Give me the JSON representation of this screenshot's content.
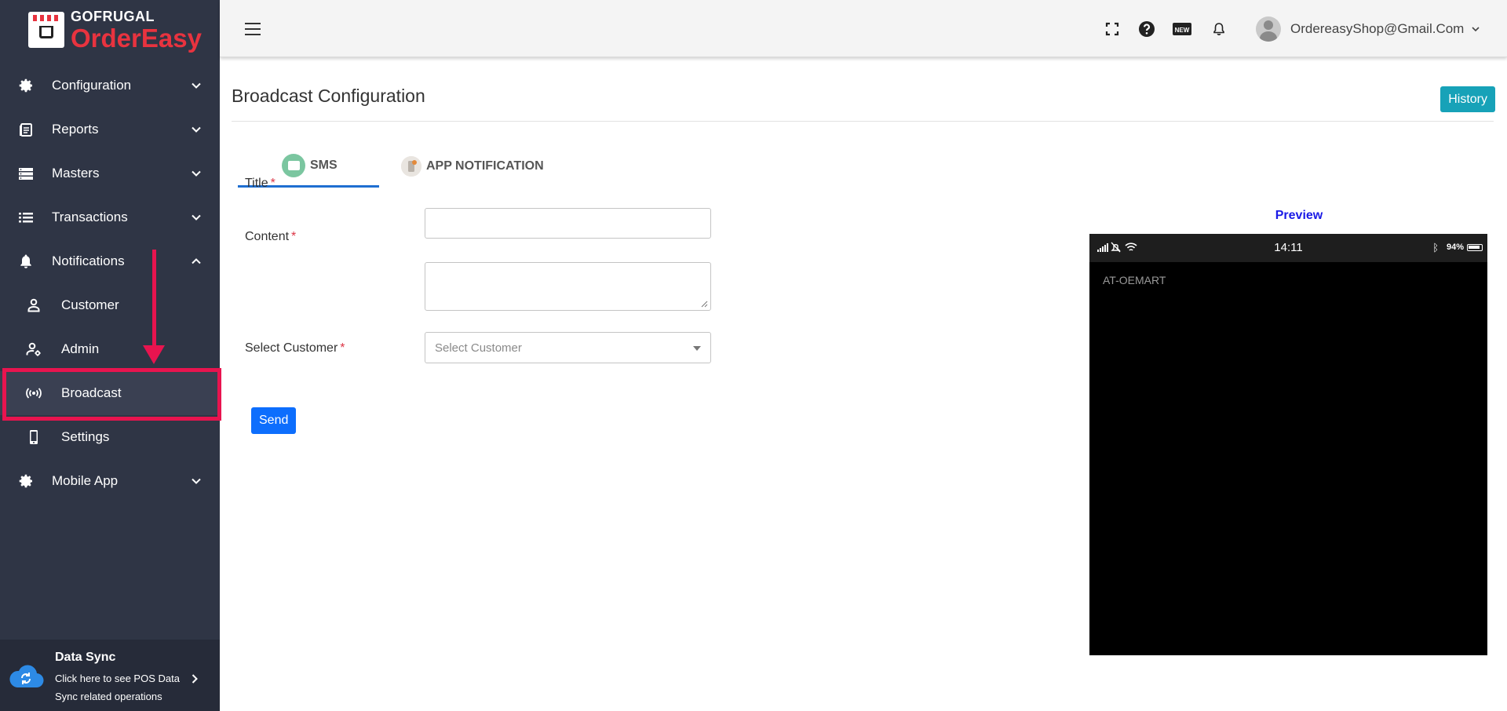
{
  "app": {
    "brand_top": "GOFRUGAL",
    "brand_bottom": "OrderEasy"
  },
  "sidebar": {
    "items": [
      {
        "label": "Configuration",
        "icon": "gear-icon"
      },
      {
        "label": "Reports",
        "icon": "reports-icon"
      },
      {
        "label": "Masters",
        "icon": "masters-icon"
      },
      {
        "label": "Transactions",
        "icon": "list-icon"
      },
      {
        "label": "Notifications",
        "icon": "bell-icon",
        "expanded": true
      },
      {
        "label": "Mobile App",
        "icon": "gear-icon"
      }
    ],
    "notifications_sub": [
      {
        "label": "Customer",
        "icon": "user-icon"
      },
      {
        "label": "Admin",
        "icon": "user-gear-icon"
      },
      {
        "label": "Broadcast",
        "icon": "broadcast-icon",
        "active": true
      },
      {
        "label": "Settings",
        "icon": "phone-icon"
      }
    ],
    "datasync": {
      "title": "Data Sync",
      "description": "Click here to see POS Data Sync related operations"
    }
  },
  "topbar": {
    "icons": [
      "fullscreen-icon",
      "help-icon",
      "new-icon",
      "bell-icon"
    ],
    "user_email": "OrdereasyShop@Gmail.Com"
  },
  "page": {
    "title": "Broadcast Configuration",
    "history_label": "History",
    "tabs": [
      {
        "label": "SMS",
        "active": true
      },
      {
        "label": "APP NOTIFICATION",
        "active": false
      }
    ],
    "form": {
      "title_label": "Title",
      "content_label": "Content",
      "customer_label": "Select Customer",
      "required_mark": "*",
      "title_value": "",
      "content_value": "",
      "customer_placeholder": "Select Customer"
    },
    "send_label": "Send",
    "preview": {
      "label": "Preview",
      "time": "14:11",
      "battery": "94%",
      "sender": "AT-OEMART"
    }
  },
  "colors": {
    "sidebar_bg": "#2f3545",
    "highlight": "#e8144f",
    "history_btn": "#17a2b8",
    "send_btn": "#0d6efd",
    "tab_underline": "#1f6fd1",
    "preview_label": "#1a1ae6",
    "brand_red": "#e8333f"
  }
}
